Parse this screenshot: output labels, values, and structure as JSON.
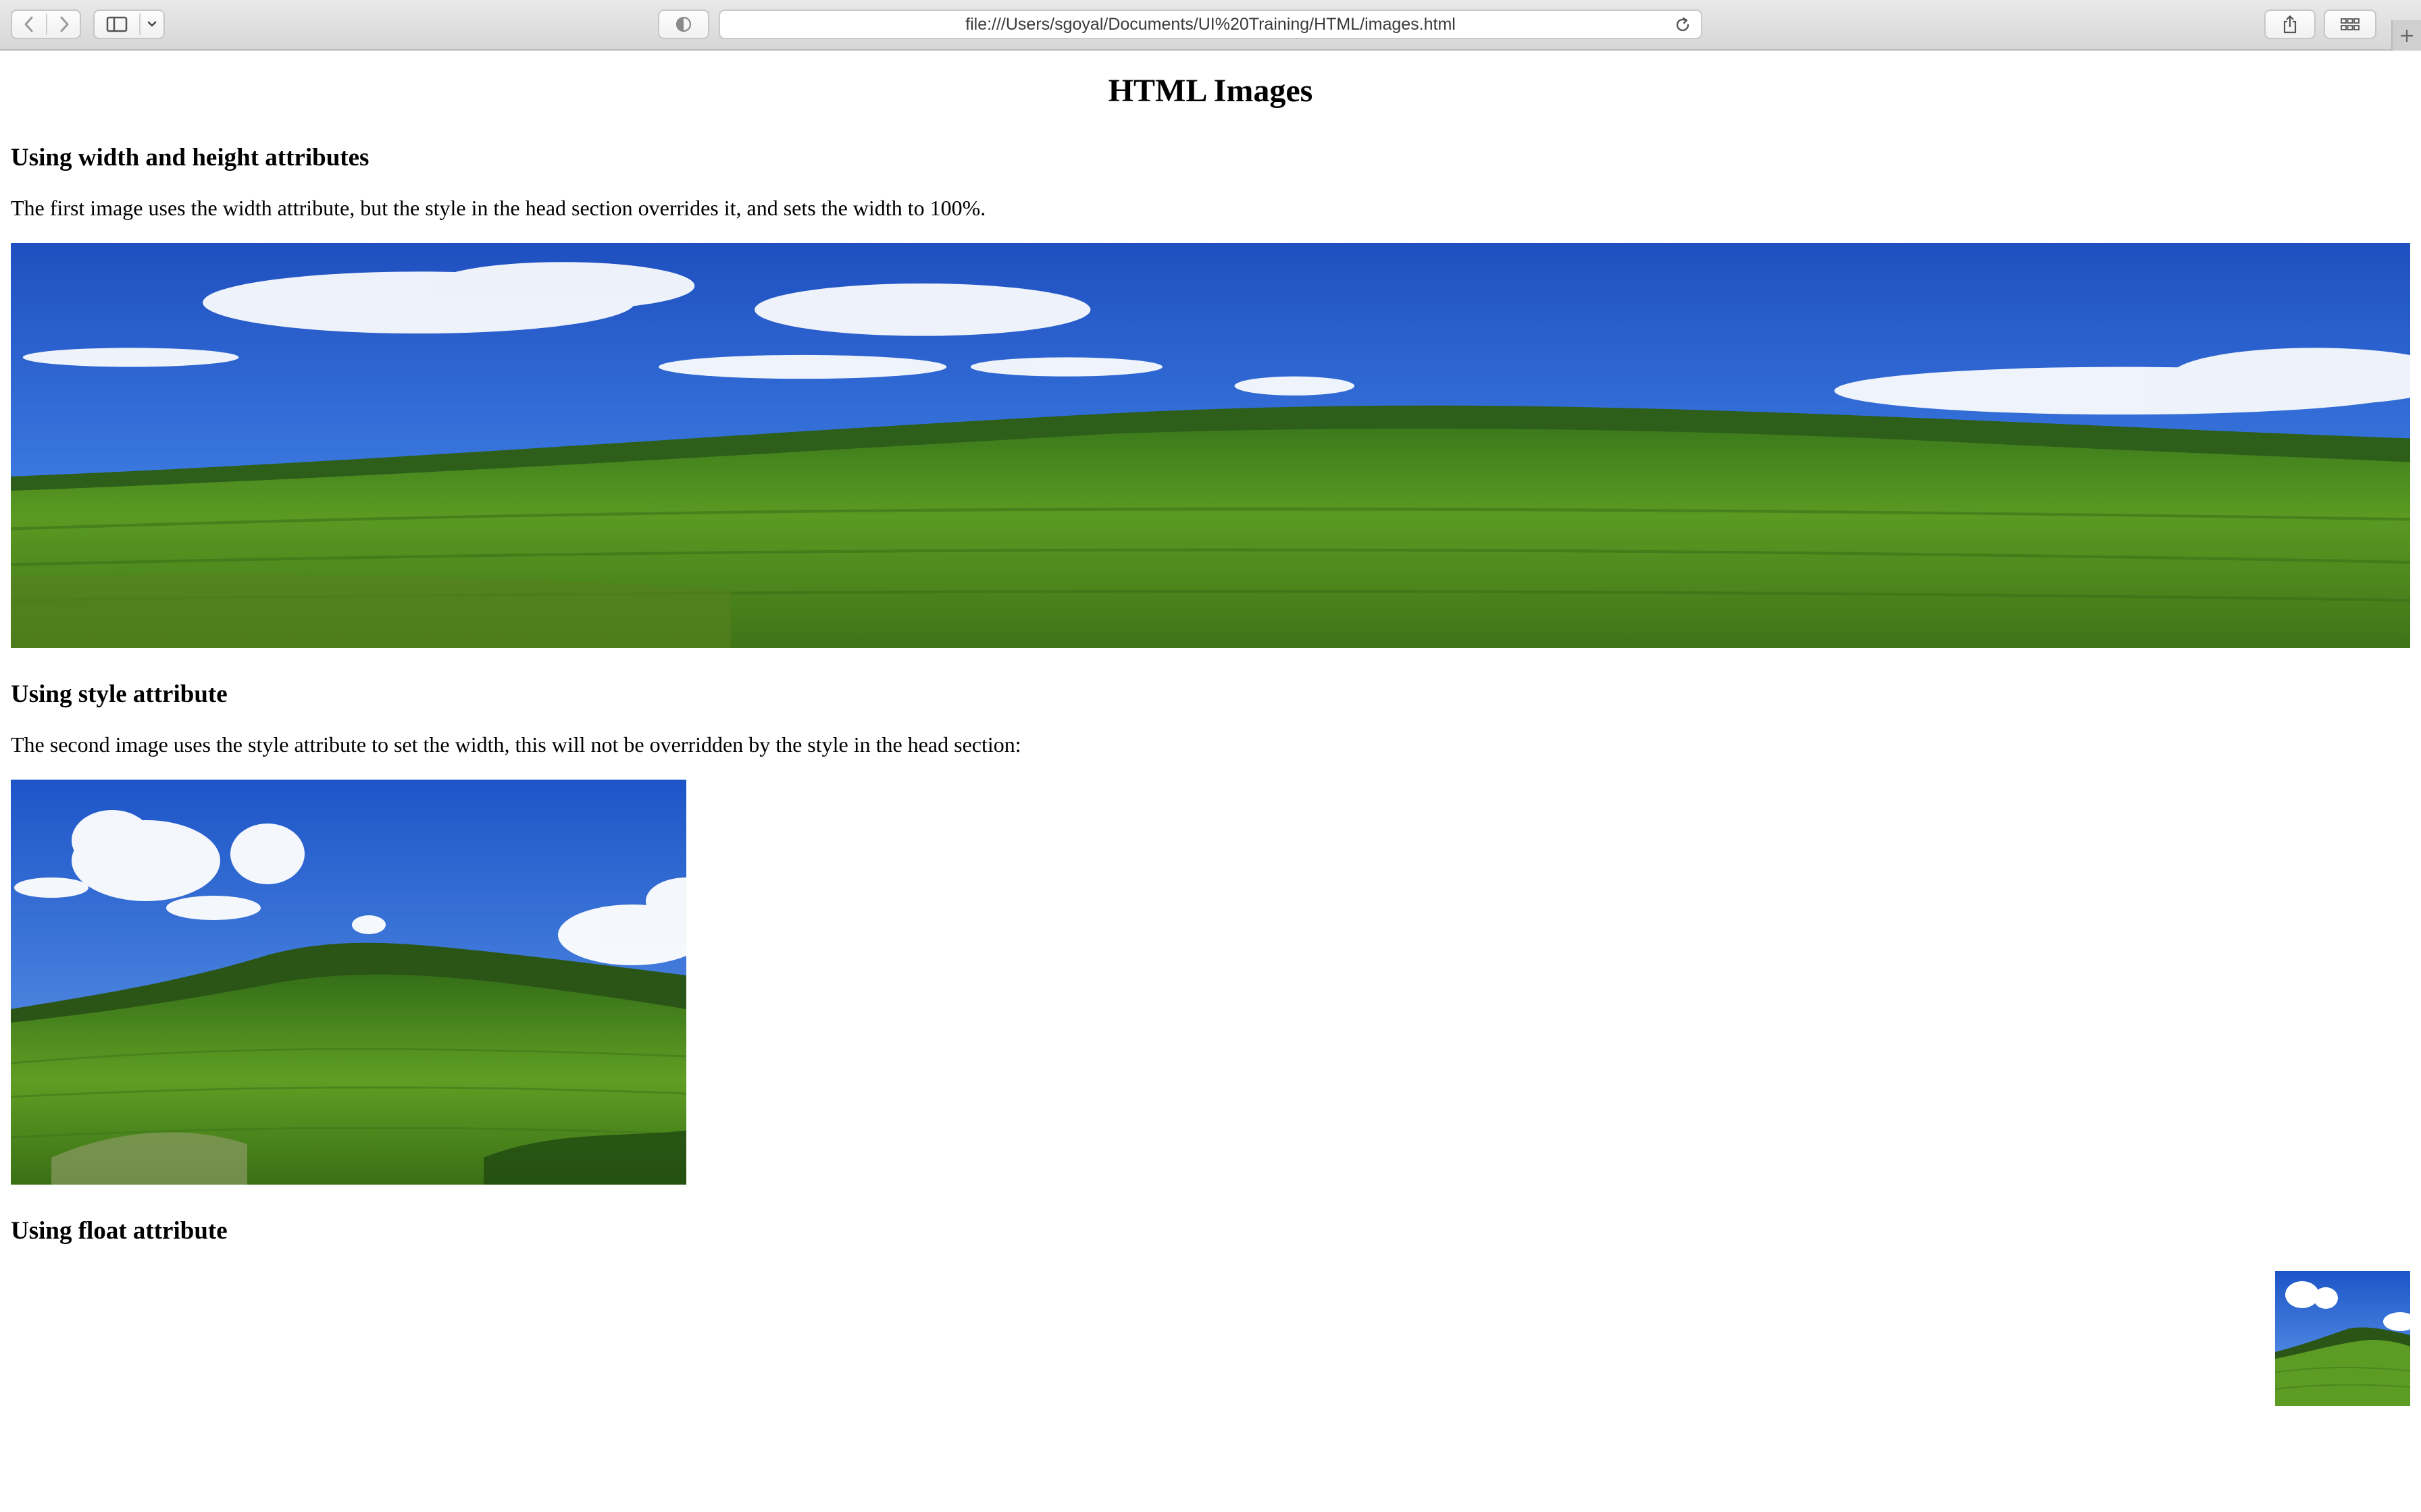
{
  "browser": {
    "url": "file:///Users/sgoyal/Documents/UI%20Training/HTML/images.html",
    "icons": [
      "back-icon",
      "forward-icon",
      "sidebar-icon",
      "chevron-down-icon",
      "privacy-shield-icon",
      "reload-icon",
      "share-icon",
      "tab-overview-icon",
      "new-tab-icon"
    ]
  },
  "page": {
    "title": "HTML Images",
    "sections": [
      {
        "heading": "Using width and height attributes",
        "text": "The first image uses the width attribute, but the style in the head section overrides it, and sets the width to 100%."
      },
      {
        "heading": "Using style attribute",
        "text": "The second image uses the style attribute to set the width, this will not be overridden by the style in the head section:"
      },
      {
        "heading": "Using float attribute"
      }
    ],
    "images": [
      {
        "name": "landscape-image-full-width",
        "subject": "green tea plantation hills under blue sky"
      },
      {
        "name": "landscape-image-styled",
        "subject": "green tea plantation hills under blue sky"
      },
      {
        "name": "landscape-image-floated",
        "subject": "green tea plantation hills under blue sky",
        "float": "right"
      }
    ]
  },
  "colors": {
    "sky": "#2f63cf",
    "grass": "#4f8f1e",
    "toolbar": "#dedede"
  }
}
